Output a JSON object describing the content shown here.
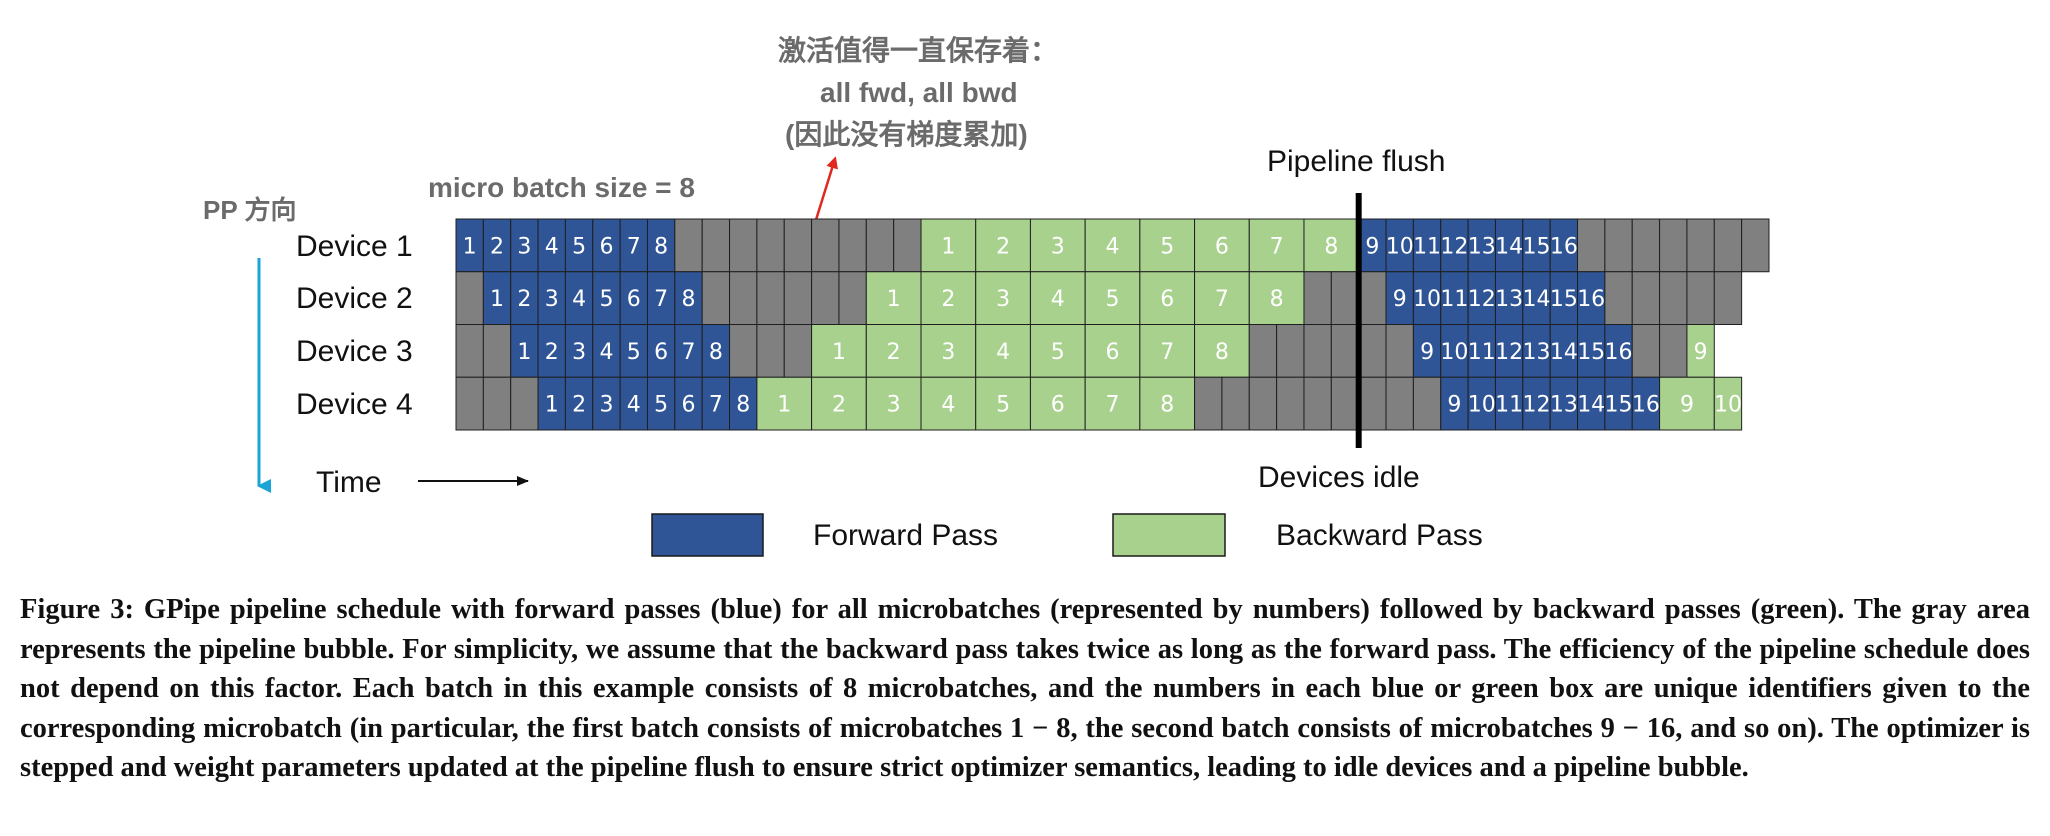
{
  "annotations": {
    "pp_direction": "PP 方向",
    "micro_batch": "micro batch size = 8",
    "activation_note_line1": "激活值得一直保存着：",
    "activation_note_line2": "all fwd, all bwd",
    "activation_note_line3": "(因此没有梯度累加)",
    "pipeline_flush": "Pipeline flush",
    "devices_idle": "Devices idle",
    "time": "Time"
  },
  "devices": [
    "Device 1",
    "Device 2",
    "Device 3",
    "Device 4"
  ],
  "legend": {
    "forward": "Forward Pass",
    "backward": "Backward Pass"
  },
  "colors": {
    "forward": "#2f5597",
    "backward": "#a9d18e",
    "idle": "#808080",
    "arrow_red": "#e0281e",
    "axis_blue": "#1aa5d6"
  },
  "schedule": {
    "total_slots": 48,
    "flush_after_slot": 33,
    "rows": [
      [
        {
          "t": "f",
          "w": 1,
          "label": "1"
        },
        {
          "t": "f",
          "w": 1,
          "label": "2"
        },
        {
          "t": "f",
          "w": 1,
          "label": "3"
        },
        {
          "t": "f",
          "w": 1,
          "label": "4"
        },
        {
          "t": "f",
          "w": 1,
          "label": "5"
        },
        {
          "t": "f",
          "w": 1,
          "label": "6"
        },
        {
          "t": "f",
          "w": 1,
          "label": "7"
        },
        {
          "t": "f",
          "w": 1,
          "label": "8"
        },
        {
          "t": "i",
          "w": 1
        },
        {
          "t": "i",
          "w": 1
        },
        {
          "t": "i",
          "w": 1
        },
        {
          "t": "i",
          "w": 1
        },
        {
          "t": "i",
          "w": 1
        },
        {
          "t": "i",
          "w": 1
        },
        {
          "t": "i",
          "w": 1
        },
        {
          "t": "i",
          "w": 1
        },
        {
          "t": "i",
          "w": 1
        },
        {
          "t": "b",
          "w": 2,
          "label": "1"
        },
        {
          "t": "b",
          "w": 2,
          "label": "2"
        },
        {
          "t": "b",
          "w": 2,
          "label": "3"
        },
        {
          "t": "b",
          "w": 2,
          "label": "4"
        },
        {
          "t": "b",
          "w": 2,
          "label": "5"
        },
        {
          "t": "b",
          "w": 2,
          "label": "6"
        },
        {
          "t": "b",
          "w": 2,
          "label": "7"
        },
        {
          "t": "b",
          "w": 2,
          "label": "8"
        },
        {
          "t": "f",
          "w": 1,
          "label": "9"
        },
        {
          "t": "f",
          "w": 1,
          "label": "10"
        },
        {
          "t": "f",
          "w": 1,
          "label": "11"
        },
        {
          "t": "f",
          "w": 1,
          "label": "12"
        },
        {
          "t": "f",
          "w": 1,
          "label": "13"
        },
        {
          "t": "f",
          "w": 1,
          "label": "14"
        },
        {
          "t": "f",
          "w": 1,
          "label": "15"
        },
        {
          "t": "f",
          "w": 1,
          "label": "16"
        },
        {
          "t": "i",
          "w": 1
        },
        {
          "t": "i",
          "w": 1
        },
        {
          "t": "i",
          "w": 1
        },
        {
          "t": "i",
          "w": 1
        },
        {
          "t": "i",
          "w": 1
        },
        {
          "t": "i",
          "w": 1
        },
        {
          "t": "i",
          "w": 1
        }
      ],
      [
        {
          "t": "i",
          "w": 1
        },
        {
          "t": "f",
          "w": 1,
          "label": "1"
        },
        {
          "t": "f",
          "w": 1,
          "label": "2"
        },
        {
          "t": "f",
          "w": 1,
          "label": "3"
        },
        {
          "t": "f",
          "w": 1,
          "label": "4"
        },
        {
          "t": "f",
          "w": 1,
          "label": "5"
        },
        {
          "t": "f",
          "w": 1,
          "label": "6"
        },
        {
          "t": "f",
          "w": 1,
          "label": "7"
        },
        {
          "t": "f",
          "w": 1,
          "label": "8"
        },
        {
          "t": "i",
          "w": 1
        },
        {
          "t": "i",
          "w": 1
        },
        {
          "t": "i",
          "w": 1
        },
        {
          "t": "i",
          "w": 1
        },
        {
          "t": "i",
          "w": 1
        },
        {
          "t": "i",
          "w": 1
        },
        {
          "t": "b",
          "w": 2,
          "label": "1"
        },
        {
          "t": "b",
          "w": 2,
          "label": "2"
        },
        {
          "t": "b",
          "w": 2,
          "label": "3"
        },
        {
          "t": "b",
          "w": 2,
          "label": "4"
        },
        {
          "t": "b",
          "w": 2,
          "label": "5"
        },
        {
          "t": "b",
          "w": 2,
          "label": "6"
        },
        {
          "t": "b",
          "w": 2,
          "label": "7"
        },
        {
          "t": "b",
          "w": 2,
          "label": "8"
        },
        {
          "t": "i",
          "w": 1
        },
        {
          "t": "i",
          "w": 1
        },
        {
          "t": "i",
          "w": 1
        },
        {
          "t": "f",
          "w": 1,
          "label": "9"
        },
        {
          "t": "f",
          "w": 1,
          "label": "10"
        },
        {
          "t": "f",
          "w": 1,
          "label": "11"
        },
        {
          "t": "f",
          "w": 1,
          "label": "12"
        },
        {
          "t": "f",
          "w": 1,
          "label": "13"
        },
        {
          "t": "f",
          "w": 1,
          "label": "14"
        },
        {
          "t": "f",
          "w": 1,
          "label": "15"
        },
        {
          "t": "f",
          "w": 1,
          "label": "16"
        },
        {
          "t": "i",
          "w": 1
        },
        {
          "t": "i",
          "w": 1
        },
        {
          "t": "i",
          "w": 1
        },
        {
          "t": "i",
          "w": 1
        },
        {
          "t": "i",
          "w": 1
        }
      ],
      [
        {
          "t": "i",
          "w": 1
        },
        {
          "t": "i",
          "w": 1
        },
        {
          "t": "f",
          "w": 1,
          "label": "1"
        },
        {
          "t": "f",
          "w": 1,
          "label": "2"
        },
        {
          "t": "f",
          "w": 1,
          "label": "3"
        },
        {
          "t": "f",
          "w": 1,
          "label": "4"
        },
        {
          "t": "f",
          "w": 1,
          "label": "5"
        },
        {
          "t": "f",
          "w": 1,
          "label": "6"
        },
        {
          "t": "f",
          "w": 1,
          "label": "7"
        },
        {
          "t": "f",
          "w": 1,
          "label": "8"
        },
        {
          "t": "i",
          "w": 1
        },
        {
          "t": "i",
          "w": 1
        },
        {
          "t": "i",
          "w": 1
        },
        {
          "t": "b",
          "w": 2,
          "label": "1"
        },
        {
          "t": "b",
          "w": 2,
          "label": "2"
        },
        {
          "t": "b",
          "w": 2,
          "label": "3"
        },
        {
          "t": "b",
          "w": 2,
          "label": "4"
        },
        {
          "t": "b",
          "w": 2,
          "label": "5"
        },
        {
          "t": "b",
          "w": 2,
          "label": "6"
        },
        {
          "t": "b",
          "w": 2,
          "label": "7"
        },
        {
          "t": "b",
          "w": 2,
          "label": "8"
        },
        {
          "t": "i",
          "w": 1
        },
        {
          "t": "i",
          "w": 1
        },
        {
          "t": "i",
          "w": 1
        },
        {
          "t": "i",
          "w": 1
        },
        {
          "t": "i",
          "w": 1
        },
        {
          "t": "i",
          "w": 1
        },
        {
          "t": "f",
          "w": 1,
          "label": "9"
        },
        {
          "t": "f",
          "w": 1,
          "label": "10"
        },
        {
          "t": "f",
          "w": 1,
          "label": "11"
        },
        {
          "t": "f",
          "w": 1,
          "label": "12"
        },
        {
          "t": "f",
          "w": 1,
          "label": "13"
        },
        {
          "t": "f",
          "w": 1,
          "label": "14"
        },
        {
          "t": "f",
          "w": 1,
          "label": "15"
        },
        {
          "t": "f",
          "w": 1,
          "label": "16"
        },
        {
          "t": "i",
          "w": 1
        },
        {
          "t": "i",
          "w": 1
        },
        {
          "t": "b",
          "w": 1,
          "label": "9"
        }
      ],
      [
        {
          "t": "i",
          "w": 1
        },
        {
          "t": "i",
          "w": 1
        },
        {
          "t": "i",
          "w": 1
        },
        {
          "t": "f",
          "w": 1,
          "label": "1"
        },
        {
          "t": "f",
          "w": 1,
          "label": "2"
        },
        {
          "t": "f",
          "w": 1,
          "label": "3"
        },
        {
          "t": "f",
          "w": 1,
          "label": "4"
        },
        {
          "t": "f",
          "w": 1,
          "label": "5"
        },
        {
          "t": "f",
          "w": 1,
          "label": "6"
        },
        {
          "t": "f",
          "w": 1,
          "label": "7"
        },
        {
          "t": "f",
          "w": 1,
          "label": "8"
        },
        {
          "t": "b",
          "w": 2,
          "label": "1"
        },
        {
          "t": "b",
          "w": 2,
          "label": "2"
        },
        {
          "t": "b",
          "w": 2,
          "label": "3"
        },
        {
          "t": "b",
          "w": 2,
          "label": "4"
        },
        {
          "t": "b",
          "w": 2,
          "label": "5"
        },
        {
          "t": "b",
          "w": 2,
          "label": "6"
        },
        {
          "t": "b",
          "w": 2,
          "label": "7"
        },
        {
          "t": "b",
          "w": 2,
          "label": "8"
        },
        {
          "t": "i",
          "w": 1
        },
        {
          "t": "i",
          "w": 1
        },
        {
          "t": "i",
          "w": 1
        },
        {
          "t": "i",
          "w": 1
        },
        {
          "t": "i",
          "w": 1
        },
        {
          "t": "i",
          "w": 1
        },
        {
          "t": "i",
          "w": 1
        },
        {
          "t": "i",
          "w": 1
        },
        {
          "t": "i",
          "w": 1
        },
        {
          "t": "f",
          "w": 1,
          "label": "9"
        },
        {
          "t": "f",
          "w": 1,
          "label": "10"
        },
        {
          "t": "f",
          "w": 1,
          "label": "11"
        },
        {
          "t": "f",
          "w": 1,
          "label": "12"
        },
        {
          "t": "f",
          "w": 1,
          "label": "13"
        },
        {
          "t": "f",
          "w": 1,
          "label": "14"
        },
        {
          "t": "f",
          "w": 1,
          "label": "15"
        },
        {
          "t": "f",
          "w": 1,
          "label": "16"
        },
        {
          "t": "b",
          "w": 2,
          "label": "9"
        },
        {
          "t": "b",
          "w": 1,
          "label": "10"
        }
      ]
    ]
  },
  "caption": "Figure 3: GPipe pipeline schedule with forward passes (blue) for all microbatches (represented by numbers) followed by backward passes (green). The gray area represents the pipeline bubble. For simplicity, we assume that the backward pass takes twice as long as the forward pass. The efficiency of the pipeline schedule does not depend on this factor. Each batch in this example consists of 8 microbatches, and the numbers in each blue or green box are unique identifiers given to the corresponding microbatch (in particular, the first batch consists of microbatches 1 − 8, the second batch consists of microbatches 9 − 16, and so on). The optimizer is stepped and weight parameters updated at the pipeline flush to ensure strict optimizer semantics, leading to idle devices and a pipeline bubble."
}
